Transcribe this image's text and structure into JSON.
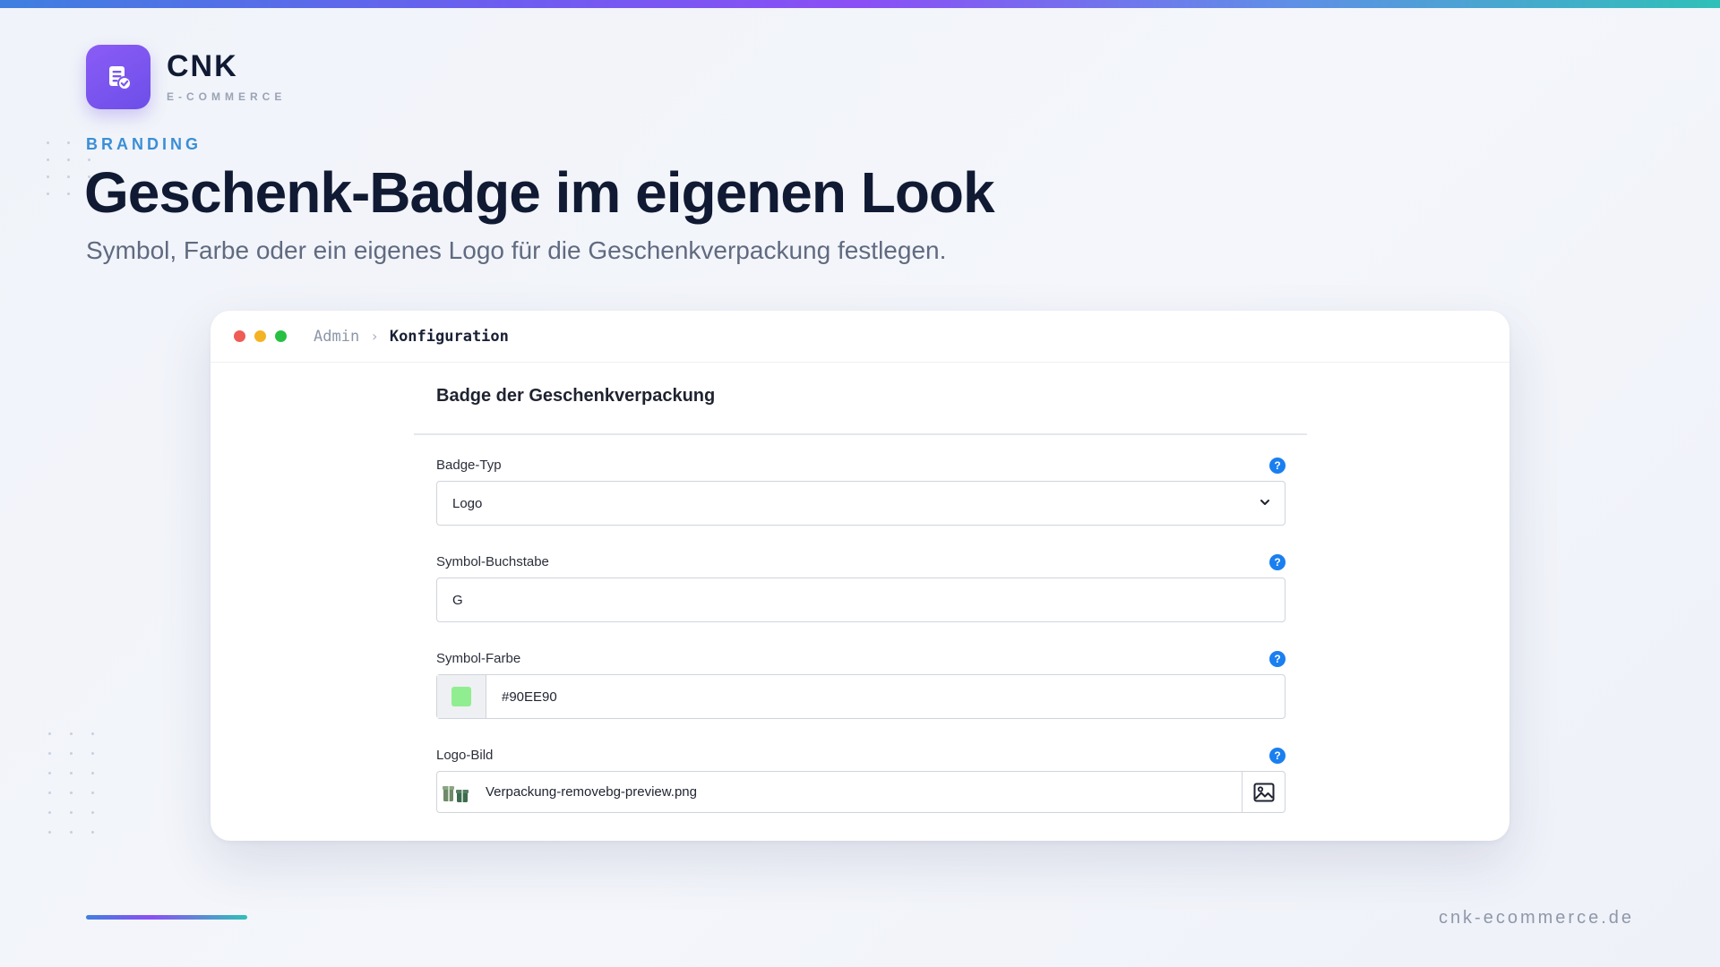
{
  "brand": {
    "name": "CNK",
    "subtitle": "E-COMMERCE",
    "logo_icon": "document-check-icon",
    "accent": "#7c5cf2"
  },
  "hero": {
    "eyebrow": "BRANDING",
    "headline": "Geschenk-Badge im eigenen Look",
    "subline": "Symbol, Farbe oder ein eigenes Logo für die Geschenkverpackung festlegen."
  },
  "window": {
    "breadcrumb": {
      "root": "Admin",
      "separator": "›",
      "current": "Konfiguration"
    },
    "section_title": "Badge der Geschenkverpackung",
    "fields": {
      "badge_type": {
        "label": "Badge-Typ",
        "value": "Logo",
        "help": "?"
      },
      "symbol_letter": {
        "label": "Symbol-Buchstabe",
        "value": "G",
        "help": "?"
      },
      "symbol_color": {
        "label": "Symbol-Farbe",
        "value": "#90EE90",
        "help": "?"
      },
      "logo_image": {
        "label": "Logo-Bild",
        "file_name": "Verpackung-removebg-preview.png",
        "help": "?",
        "button_icon": "image-icon"
      }
    }
  },
  "footer": {
    "url": "cnk-ecommerce.de"
  }
}
